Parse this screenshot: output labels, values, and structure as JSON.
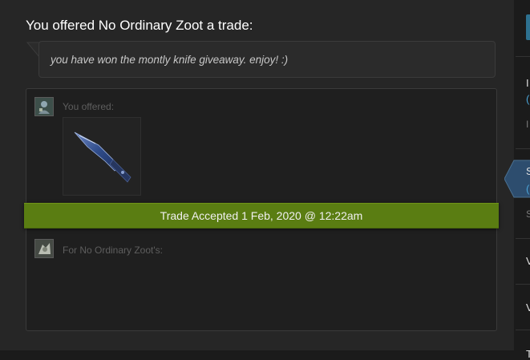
{
  "trade": {
    "heading": "You offered No Ordinary Zoot a trade:",
    "message": "you have won the montly knife giveaway. enjoy! :)",
    "your_offer_label": "You offered:",
    "their_offer_label": "For No Ordinary Zoot's:",
    "status_banner": "Trade Accepted 1 Feb, 2020 @ 12:22am",
    "status_color": "#5a7d12",
    "offered_items": [
      {
        "icon": "knife-icon",
        "accent_color": "#3a5a9a"
      }
    ]
  },
  "sidebar": {
    "partial_texts": [
      "I",
      "(",
      "I",
      "S",
      "(",
      "S",
      "V",
      "V",
      "T"
    ],
    "accent_color": "#2d7190",
    "link_color": "#4aa3d6"
  }
}
